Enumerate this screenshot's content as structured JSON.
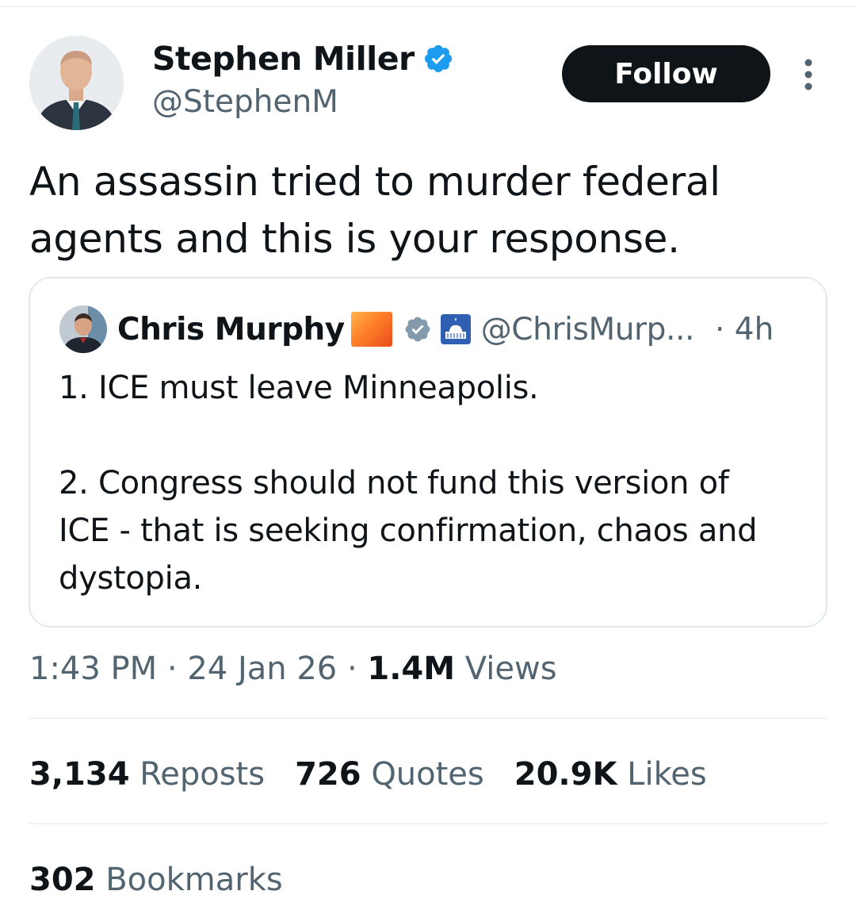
{
  "colors": {
    "text_primary": "#0f1419",
    "text_secondary": "#536471",
    "verified_blue": "#1d9bf0",
    "gov_badge_gray": "#829aab",
    "follow_bg": "#0f1419"
  },
  "tweet": {
    "author": {
      "name": "Stephen Miller",
      "handle": "@StephenM",
      "verified_icon": "verified-badge-icon",
      "avatar_icon": "avatar-photo"
    },
    "follow_label": "Follow",
    "more_icon": "more-vertical-icon",
    "text": "An assassin tried to murder federal\nagents and this is your response.",
    "quote": {
      "name": "Chris Murphy",
      "flag_icon": "orange-square-emoji",
      "badge_icon": "gov-verified-badge-icon",
      "capitol_icon": "capitol-building-icon",
      "handle": "@ChrisMurp...",
      "time": "· 4h",
      "text": "1. ICE must leave Minneapolis.\n\n2. Congress should not fund this version of\nICE - that is seeking confirmation, chaos and\ndystopia."
    },
    "meta": {
      "time": "1:43 PM",
      "sep1": "·",
      "date": "24 Jan 26",
      "sep2": "·",
      "views_count": "1.4M",
      "views_label": "Views"
    },
    "stats": {
      "reposts_count": "3,134",
      "reposts_label": "Reposts",
      "quotes_count": "726",
      "quotes_label": "Quotes",
      "likes_count": "20.9K",
      "likes_label": "Likes",
      "bookmarks_count": "302",
      "bookmarks_label": "Bookmarks"
    }
  }
}
